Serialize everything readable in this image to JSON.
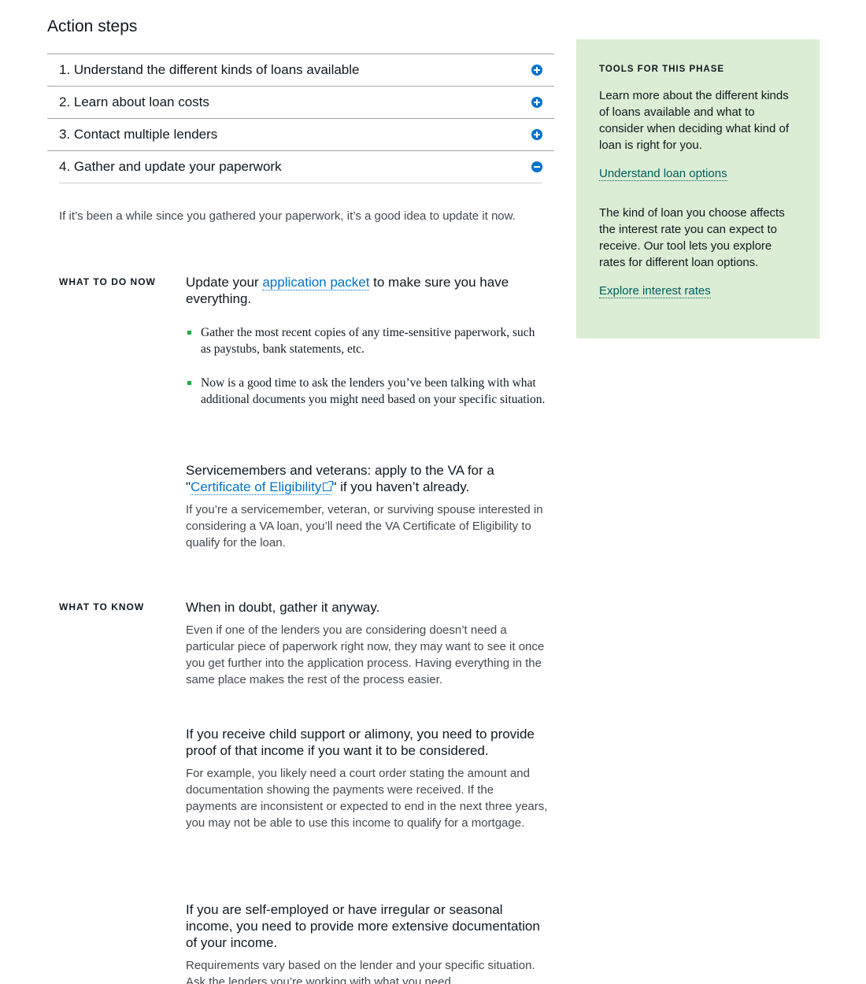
{
  "page_title": "Action steps",
  "accordion": {
    "items": [
      {
        "label": "1. Understand the different kinds of loans available",
        "state": "collapsed",
        "icon": "plus-circle-icon"
      },
      {
        "label": "2. Learn about loan costs",
        "state": "collapsed",
        "icon": "plus-circle-icon"
      },
      {
        "label": "3. Contact multiple lenders",
        "state": "collapsed",
        "icon": "plus-circle-icon"
      },
      {
        "label": "4. Gather and update your paperwork",
        "state": "expanded",
        "icon": "minus-circle-icon"
      }
    ]
  },
  "expanded": {
    "intro": "If it’s been a while since you gathered your paperwork, it’s a good idea to update it now.",
    "what_to_do_now": {
      "label": "WHAT TO DO NOW",
      "item1": {
        "heading_before": "Update your ",
        "heading_link": "application packet",
        "heading_after": " to make sure you have everything.",
        "bullets": [
          "Gather the most recent copies of any time-sensitive paperwork, such as paystubs, bank statements, etc.",
          "Now is a good time to ask the lenders you’ve been talking with what additional documents you might need based on your specific situation."
        ]
      },
      "item2": {
        "heading_before": "Servicemembers and veterans: apply to the VA for a \"",
        "heading_link": "Certificate of Eligibility",
        "heading_after": "\" if you haven’t already.",
        "link_icon": "external-link-icon",
        "body": "If you’re a servicemember, veteran, or surviving spouse interested in considering a VA loan, you’ll need the VA Certificate of Eligibility to qualify for the loan."
      }
    },
    "what_to_know": {
      "label": "WHAT TO KNOW",
      "items": [
        {
          "heading": "When in doubt, gather it anyway.",
          "body": "Even if one of the lenders you are considering doesn’t need a particular piece of paperwork right now, they may want to see it once you get further into the application process. Having everything in the same place makes the rest of the process easier."
        },
        {
          "heading": "If you receive child support or alimony, you need to provide proof of that income if you want it to be considered.",
          "body": "For example, you likely need a court order stating the amount and documentation showing the payments were received. If the payments are inconsistent or expected to end in the next three years, you may not be able to use this income to qualify for a mortgage."
        },
        {
          "heading": "If you are self-employed or have irregular or seasonal income, you need to provide more extensive documentation of your income.",
          "body": "Requirements vary based on the lender and your specific situation. Ask the lenders you’re working with what you need"
        }
      ]
    }
  },
  "sidebar": {
    "heading": "TOOLS FOR THIS PHASE",
    "groups": [
      {
        "text": "Learn more about the different kinds of loans available and what to consider when deciding what kind of loan is right for you.",
        "link": "Understand loan options"
      },
      {
        "text": "The kind of loan you choose affects the interest rate you can expect to receive. Our tool lets you explore rates for different loan options.",
        "link": "Explore interest rates"
      }
    ]
  },
  "colors": {
    "accent_blue": "#0072ce",
    "sidebar_bg": "#dbedd4",
    "sidebar_link": "#005e5d",
    "bullet_green": "#20aa3f"
  }
}
